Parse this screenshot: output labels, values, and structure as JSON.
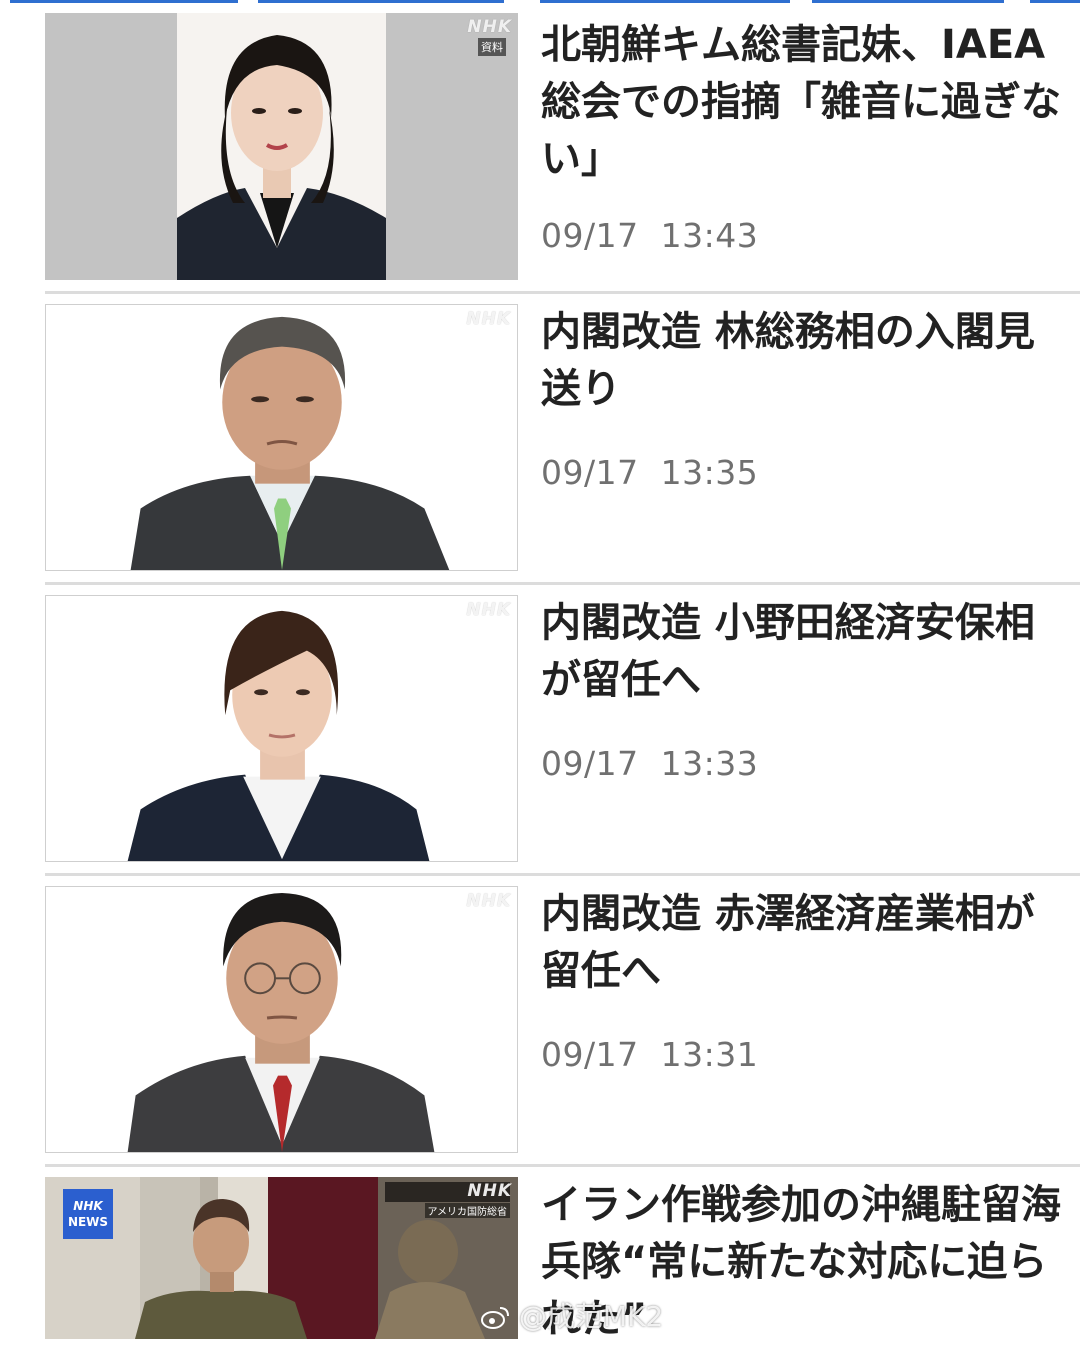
{
  "news": [
    {
      "headline": "北朝鮮キム総書記妹、IAEA総会での指摘「雑音に過ぎない」",
      "date": "09/17",
      "time": "13:43",
      "thumb_logo": "NHK",
      "thumb_tag": "資料"
    },
    {
      "headline": "内閣改造 林総務相の入閣見送り",
      "date": "09/17",
      "time": "13:35",
      "thumb_logo": "NHK"
    },
    {
      "headline": "内閣改造 小野田経済安保相が留任へ",
      "date": "09/17",
      "time": "13:33",
      "thumb_logo": "NHK"
    },
    {
      "headline": "内閣改造 赤澤経済産業相が留任へ",
      "date": "09/17",
      "time": "13:31",
      "thumb_logo": "NHK"
    },
    {
      "headline": "イラン作戦参加の沖縄駐留海兵隊“常に新たな対応に迫られた”",
      "thumb_logo": "NHK",
      "thumb_badge_top": "NHK",
      "thumb_badge_bottom": "NEWS",
      "thumb_channel": "アメリカ国防総省"
    }
  ],
  "watermark": "@成范MK2",
  "colors": {
    "headline": "#222222",
    "timestamp": "#707070",
    "divider": "#dcdcdc",
    "accent": "#2f6fd0"
  }
}
